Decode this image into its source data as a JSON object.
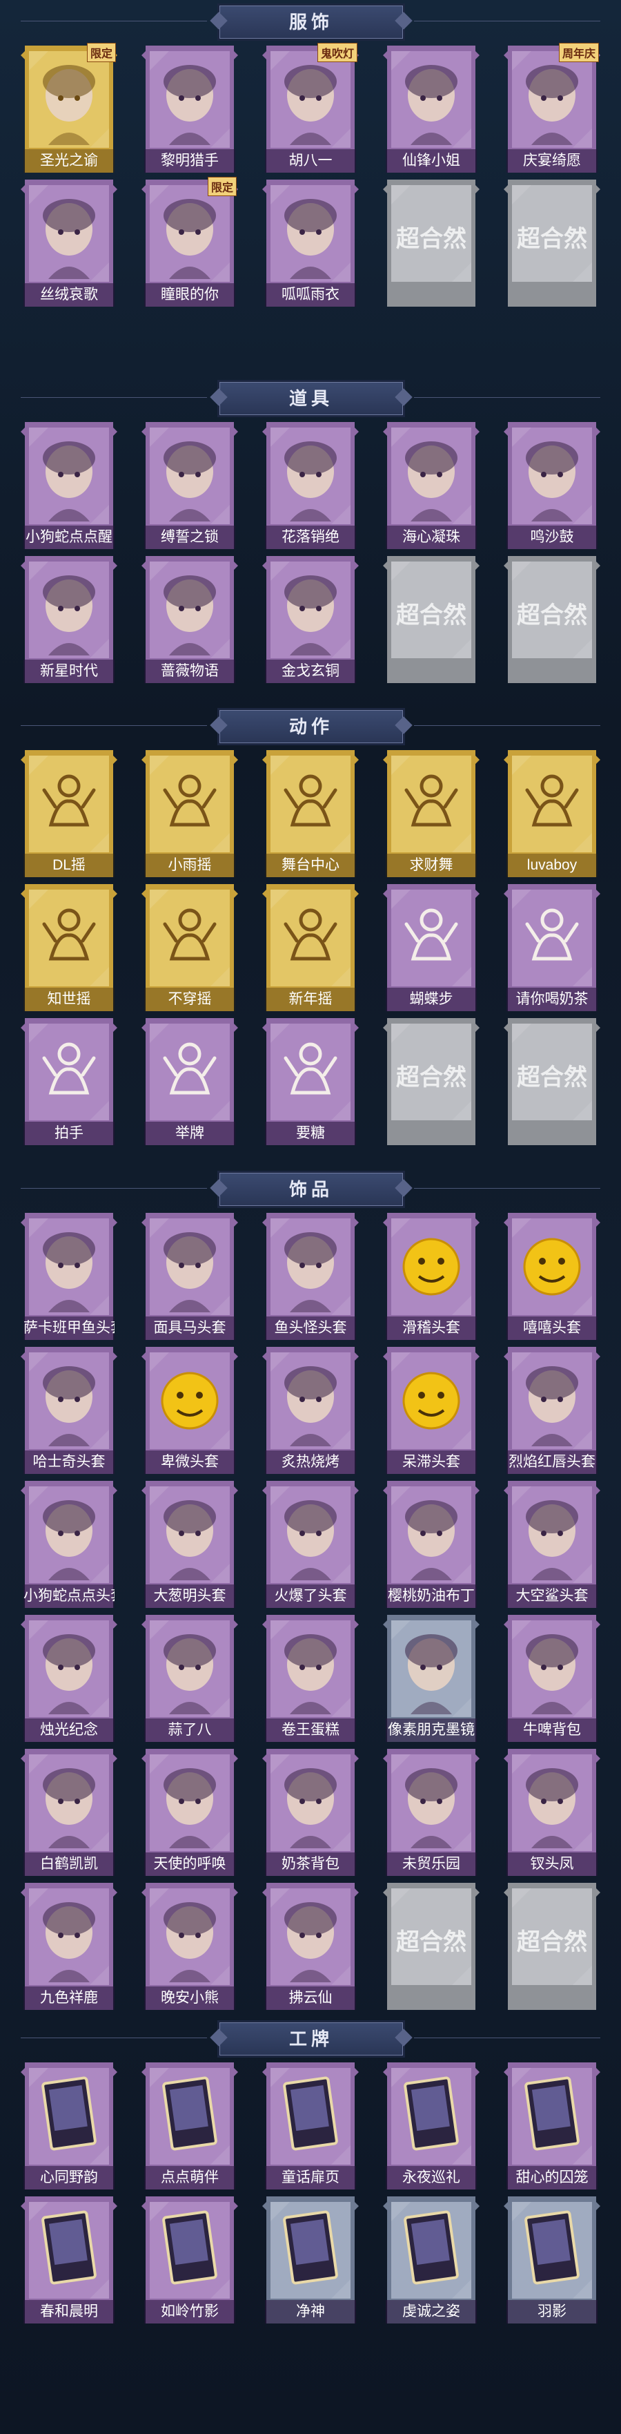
{
  "sections": [
    {
      "title": "服饰",
      "items": [
        {
          "label": "圣光之谕",
          "style": "gold",
          "tag": "限定",
          "icon": "blonde-girl-icon"
        },
        {
          "label": "黎明猎手",
          "style": "purple",
          "tag": "",
          "icon": "boy-portrait-icon"
        },
        {
          "label": "胡八一",
          "style": "purple",
          "tag": "鬼吹灯",
          "icon": "hunter-portrait-icon"
        },
        {
          "label": "仙锋小姐",
          "style": "purple",
          "tag": "",
          "icon": "girl-portrait-icon"
        },
        {
          "label": "庆宴绮愿",
          "style": "purple",
          "tag": "周年庆",
          "icon": "girl-cake-icon"
        },
        {
          "label": "丝绒哀歌",
          "style": "purple",
          "tag": "",
          "icon": "dark-girl-icon"
        },
        {
          "label": "瞳眼的你",
          "style": "purple",
          "tag": "限定",
          "icon": "cowgirl-icon"
        },
        {
          "label": "呱呱雨衣",
          "style": "purple",
          "tag": "",
          "icon": "frog-hood-icon"
        },
        {
          "label": "",
          "style": "grey",
          "tag": "",
          "icon": "placeholder-icon",
          "watermark": "超合然"
        },
        {
          "label": "",
          "style": "grey",
          "tag": "",
          "icon": "placeholder-icon",
          "watermark": "超合然"
        }
      ]
    },
    {
      "title": "道具",
      "items": [
        {
          "label": "小狗蛇点点醒",
          "style": "purple",
          "tag": "",
          "icon": "snake-toy-icon"
        },
        {
          "label": "缚誓之锁",
          "style": "purple",
          "tag": "",
          "icon": "chain-lock-icon"
        },
        {
          "label": "花落销绝",
          "style": "purple",
          "tag": "",
          "icon": "flower-staff-icon"
        },
        {
          "label": "海心凝珠",
          "style": "purple",
          "tag": "",
          "icon": "pearl-shell-icon"
        },
        {
          "label": "鸣沙鼓",
          "style": "purple",
          "tag": "",
          "icon": "drum-icon"
        },
        {
          "label": "新星时代",
          "style": "purple",
          "tag": "",
          "icon": "revolver-icon"
        },
        {
          "label": "蔷薇物语",
          "style": "purple",
          "tag": "",
          "icon": "medkit-icon"
        },
        {
          "label": "金戈玄铜",
          "style": "purple",
          "tag": "",
          "icon": "grenade-icon"
        },
        {
          "label": "",
          "style": "grey",
          "tag": "",
          "icon": "placeholder-icon",
          "watermark": "超合然"
        },
        {
          "label": "",
          "style": "grey",
          "tag": "",
          "icon": "placeholder-icon",
          "watermark": "超合然"
        }
      ]
    },
    {
      "title": "动作",
      "items": [
        {
          "label": "DL摇",
          "style": "gold",
          "tag": "",
          "icon": "dance-pose-icon"
        },
        {
          "label": "小雨摇",
          "style": "gold",
          "tag": "",
          "icon": "dance-pose-icon"
        },
        {
          "label": "舞台中心",
          "style": "gold",
          "tag": "",
          "icon": "dance-pose-icon"
        },
        {
          "label": "求财舞",
          "style": "gold",
          "tag": "",
          "icon": "dance-pose-icon"
        },
        {
          "label": "luvaboy",
          "style": "gold",
          "tag": "",
          "icon": "dance-pose-icon"
        },
        {
          "label": "知世摇",
          "style": "gold",
          "tag": "",
          "icon": "dance-pose-icon"
        },
        {
          "label": "不穿摇",
          "style": "gold",
          "tag": "",
          "icon": "dance-pose-icon"
        },
        {
          "label": "新年摇",
          "style": "gold",
          "tag": "",
          "icon": "dance-pose-icon"
        },
        {
          "label": "蝴蝶步",
          "style": "purple",
          "tag": "",
          "icon": "dance-pose-icon"
        },
        {
          "label": "请你喝奶茶",
          "style": "purple",
          "tag": "",
          "icon": "milktea-pose-icon"
        },
        {
          "label": "拍手",
          "style": "purple",
          "tag": "",
          "icon": "clap-pose-icon"
        },
        {
          "label": "举牌",
          "style": "purple",
          "tag": "",
          "icon": "sign-pose-icon"
        },
        {
          "label": "要糖",
          "style": "purple",
          "tag": "",
          "icon": "candy-pose-icon"
        },
        {
          "label": "",
          "style": "grey",
          "tag": "",
          "icon": "placeholder-icon",
          "watermark": "超合然"
        },
        {
          "label": "",
          "style": "grey",
          "tag": "",
          "icon": "placeholder-icon",
          "watermark": "超合然"
        }
      ]
    },
    {
      "title": "饰品",
      "items": [
        {
          "label": "萨卡班甲鱼头套",
          "style": "purple",
          "tag": "",
          "icon": "fish-head-icon"
        },
        {
          "label": "面具马头套",
          "style": "purple",
          "tag": "",
          "icon": "horse-head-icon"
        },
        {
          "label": "鱼头怪头套",
          "style": "purple",
          "tag": "",
          "icon": "fishman-head-icon"
        },
        {
          "label": "滑稽头套",
          "style": "purple",
          "tag": "",
          "icon": "smirk-emoji-icon"
        },
        {
          "label": "嘻嘻头套",
          "style": "purple",
          "tag": "",
          "icon": "grin-emoji-icon"
        },
        {
          "label": "哈士奇头套",
          "style": "purple",
          "tag": "",
          "icon": "husky-head-icon"
        },
        {
          "label": "卑微头套",
          "style": "purple",
          "tag": "",
          "icon": "sad-emoji-icon"
        },
        {
          "label": "炙热烧烤",
          "style": "purple",
          "tag": "",
          "icon": "toast-head-icon"
        },
        {
          "label": "呆滞头套",
          "style": "purple",
          "tag": "",
          "icon": "dazed-emoji-icon"
        },
        {
          "label": "烈焰红唇头套",
          "style": "purple",
          "tag": "",
          "icon": "pikachu-head-icon"
        },
        {
          "label": "小狗蛇点点头套",
          "style": "purple",
          "tag": "",
          "icon": "snake-head-icon"
        },
        {
          "label": "大葱明头套",
          "style": "purple",
          "tag": "",
          "icon": "cabbage-head-icon"
        },
        {
          "label": "火爆了头套",
          "style": "purple",
          "tag": "",
          "icon": "flame-head-icon"
        },
        {
          "label": "樱桃奶油布丁",
          "style": "purple",
          "tag": "",
          "icon": "pudding-head-icon"
        },
        {
          "label": "大空鲨头套",
          "style": "purple",
          "tag": "",
          "icon": "shark-head-icon"
        },
        {
          "label": "烛光纪念",
          "style": "purple",
          "tag": "",
          "icon": "candle-icon"
        },
        {
          "label": "蒜了八",
          "style": "purple",
          "tag": "",
          "icon": "garlic-icon"
        },
        {
          "label": "卷王蛋糕",
          "style": "purple",
          "tag": "",
          "icon": "cake-roll-icon"
        },
        {
          "label": "像素朋克墨镜",
          "style": "grey-blue",
          "tag": "",
          "icon": "pixel-glasses-icon"
        },
        {
          "label": "牛啤背包",
          "style": "purple",
          "tag": "",
          "icon": "cow-backpack-icon"
        },
        {
          "label": "白鹤凯凯",
          "style": "purple",
          "tag": "",
          "icon": "crane-plush-icon"
        },
        {
          "label": "天使的呼唤",
          "style": "purple",
          "tag": "",
          "icon": "angel-doll-icon"
        },
        {
          "label": "奶茶背包",
          "style": "purple",
          "tag": "",
          "icon": "milktea-bag-icon"
        },
        {
          "label": "未贸乐园",
          "style": "purple",
          "tag": "",
          "icon": "fairy-doll-icon"
        },
        {
          "label": "钗头凤",
          "style": "purple",
          "tag": "",
          "icon": "phoenix-crown-icon"
        },
        {
          "label": "九色祥鹿",
          "style": "purple",
          "tag": "",
          "icon": "deer-icon"
        },
        {
          "label": "晚安小熊",
          "style": "purple",
          "tag": "",
          "icon": "bear-charm-icon"
        },
        {
          "label": "拂云仙",
          "style": "purple",
          "tag": "",
          "icon": "fairy-charm-icon"
        },
        {
          "label": "",
          "style": "grey",
          "tag": "",
          "icon": "placeholder-icon",
          "watermark": "超合然"
        },
        {
          "label": "",
          "style": "grey",
          "tag": "",
          "icon": "placeholder-icon",
          "watermark": "超合然"
        }
      ]
    },
    {
      "title": "工牌",
      "items": [
        {
          "label": "心同野韵",
          "style": "purple",
          "tag": "",
          "icon": "badge-card-icon"
        },
        {
          "label": "点点萌伴",
          "style": "purple",
          "tag": "",
          "icon": "badge-card-icon"
        },
        {
          "label": "童话扉页",
          "style": "purple",
          "tag": "",
          "icon": "badge-card-icon"
        },
        {
          "label": "永夜巡礼",
          "style": "purple",
          "tag": "",
          "icon": "badge-card-icon"
        },
        {
          "label": "甜心的囚笼",
          "style": "purple",
          "tag": "",
          "icon": "badge-card-icon"
        },
        {
          "label": "春和晨明",
          "style": "purple",
          "tag": "",
          "icon": "badge-card-icon"
        },
        {
          "label": "如岭竹影",
          "style": "purple",
          "tag": "",
          "icon": "badge-card-icon"
        },
        {
          "label": "净神",
          "style": "grey-blue",
          "tag": "",
          "icon": "badge-card-icon"
        },
        {
          "label": "虔诚之姿",
          "style": "grey-blue",
          "tag": "",
          "icon": "badge-card-icon"
        },
        {
          "label": "羽影",
          "style": "grey-blue",
          "tag": "",
          "icon": "badge-card-icon"
        }
      ]
    }
  ],
  "colors": {
    "purple_frame": "#8f6aa6",
    "purple_inner": "#b38ec7",
    "gold_frame": "#c9a23a",
    "gold_inner": "#e8cc6e",
    "grey_frame": "#8f9297",
    "grey_inner": "#c4c6ca",
    "greyblue_frame": "#6e7b93",
    "greyblue_inner": "#a9b4c8",
    "background": "#0f1b2b"
  }
}
